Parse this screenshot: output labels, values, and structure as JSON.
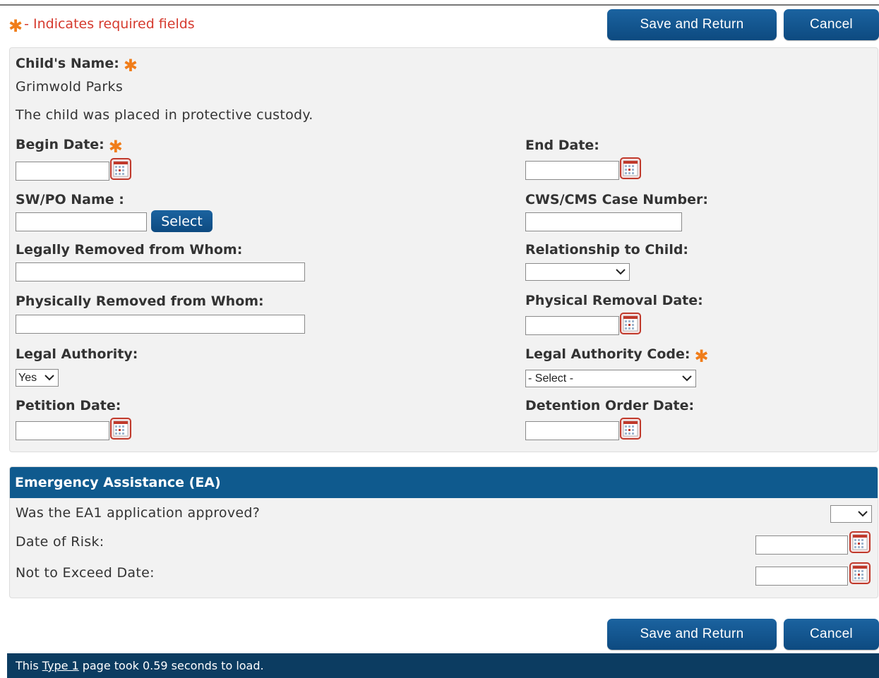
{
  "required_note": "- Indicates required fields",
  "required_star": "✱",
  "buttons": {
    "save": "Save and Return",
    "cancel": "Cancel",
    "select": "Select"
  },
  "child": {
    "label": "Child's Name:",
    "value": "Grimwold Parks",
    "status": "The child was placed in protective custody."
  },
  "fields": {
    "begin_date": {
      "label": "Begin Date:",
      "value": ""
    },
    "end_date": {
      "label": "End Date:",
      "value": ""
    },
    "sw_po_name": {
      "label": "SW/PO Name :",
      "value": ""
    },
    "cws_case_number": {
      "label": "CWS/CMS Case Number:",
      "value": ""
    },
    "legally_removed": {
      "label": "Legally Removed from Whom:",
      "value": ""
    },
    "relationship": {
      "label": "Relationship to Child:",
      "selected": ""
    },
    "physically_removed": {
      "label": "Physically Removed from Whom:",
      "value": ""
    },
    "physical_removal_date": {
      "label": "Physical Removal Date:",
      "value": ""
    },
    "legal_authority": {
      "label": "Legal Authority:",
      "selected": "Yes"
    },
    "legal_authority_code": {
      "label": "Legal Authority Code:",
      "selected": "- Select -"
    },
    "petition_date": {
      "label": "Petition Date:",
      "value": ""
    },
    "detention_order_date": {
      "label": "Detention Order Date:",
      "value": ""
    }
  },
  "ea": {
    "title": "Emergency Assistance (EA)",
    "approved_question": "Was the EA1 application approved?",
    "approved_selected": "",
    "date_of_risk": "Date of Risk:",
    "not_to_exceed": "Not to Exceed Date:"
  },
  "footer": {
    "prefix": "This",
    "link": "Type 1",
    "suffix": "page took 0.59 seconds to load."
  },
  "colors": {
    "primary_button": "#0d4a80",
    "header_bar": "#0f5a8e",
    "footer_bar": "#0c3c61",
    "required_star": "#f07d1a",
    "required_text": "#d53a2e",
    "panel_bg": "#f2f2f2"
  },
  "icons": {
    "calendar": "calendar-icon",
    "dropdown": "chevron-down-icon"
  }
}
